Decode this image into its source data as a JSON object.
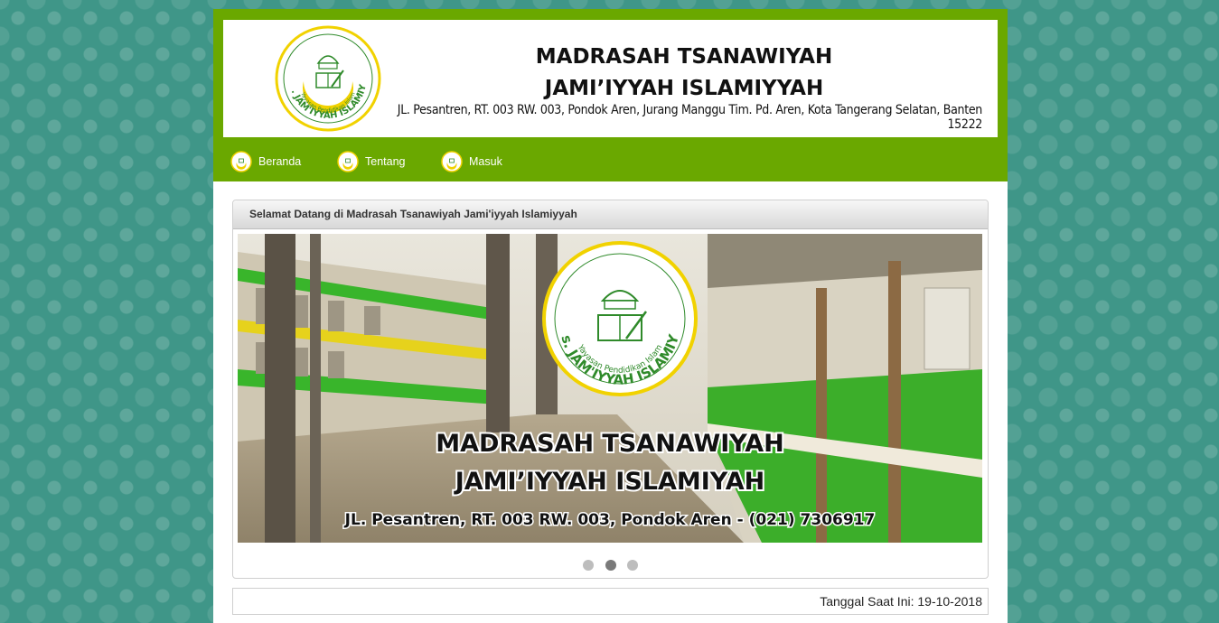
{
  "header": {
    "title_line1": "MADRASAH TSANAWIYAH",
    "title_line2": "JAMI’IYYAH ISLAMIYYAH",
    "address": "JL. Pesantren, RT. 003 RW. 003, Pondok Aren, Jurang Manggu Tim. Pd. Aren, Kota Tangerang Selatan, Banten 15222",
    "logo_text": "MTs. JAM'IYYAH ISLAMIYAH",
    "logo_subtext": "Yayasan Pendidikan Islam"
  },
  "nav": {
    "items": [
      {
        "label": "Beranda",
        "icon": "school-logo-icon"
      },
      {
        "label": "Tentang",
        "icon": "school-logo-icon"
      },
      {
        "label": "Masuk",
        "icon": "school-logo-icon"
      }
    ]
  },
  "panel": {
    "heading": "Selamat Datang di Madrasah Tsanawiyah Jami'iyyah Islamiyyah"
  },
  "slide": {
    "title_line1": "MADRASAH TSANAWIYAH",
    "title_line2": "JAMI’IYYAH ISLAMIYAH",
    "address": "JL. Pesantren, RT. 003 RW. 003, Pondok Aren - (021) 7306917",
    "logo_text": "MTs. JAM'IYYAH ISLAMIYAH",
    "logo_subtext": "Yayasan Pendidikan Islam",
    "count": 3,
    "active_index": 1
  },
  "footer": {
    "date_text": "Tanggal Saat Ini: 19-10-2018"
  },
  "colors": {
    "header_green": "#6aa800",
    "page_teal": "#3f9688",
    "logo_yellow": "#f1d200",
    "logo_green": "#2f8a2a"
  }
}
